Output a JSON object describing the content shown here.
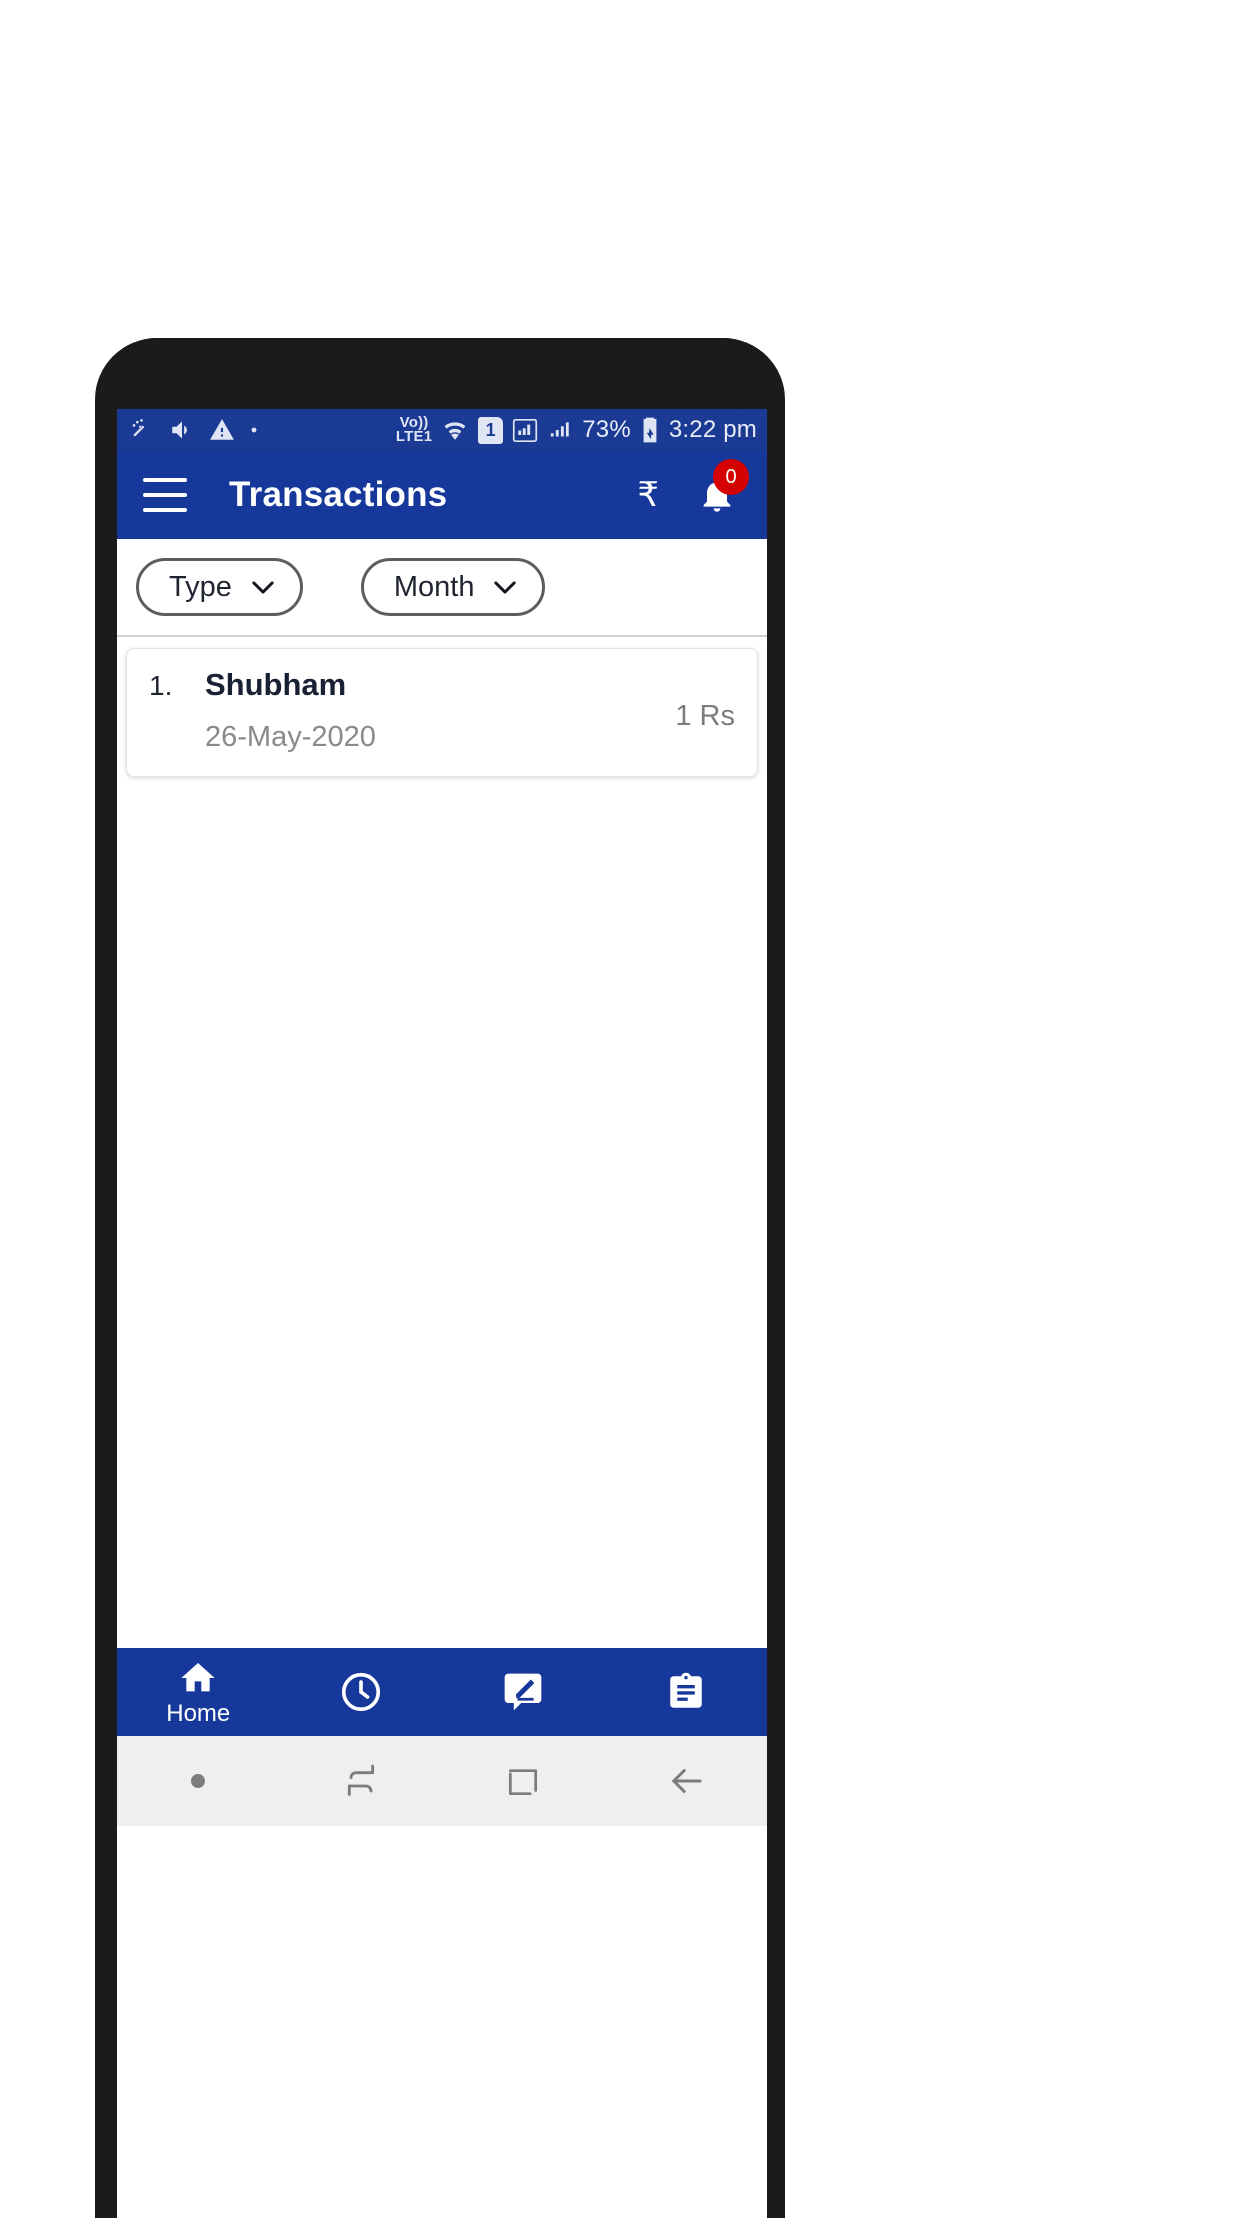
{
  "status_bar": {
    "left_icons": [
      "magic-wand-icon",
      "volume-icon",
      "warning-icon",
      "dot-icon"
    ],
    "network_label": "Vo)) LTE1",
    "network_line1": "Vo))",
    "network_line2": "LTE1",
    "right_icons": [
      "wifi-icon",
      "sim1-icon",
      "signal-icon",
      "signal2-icon"
    ],
    "sim_label": "1",
    "battery_percent": "73%",
    "battery_icon": "battery-charging-icon",
    "time": "3:22 pm"
  },
  "app_bar": {
    "menu_icon": "hamburger-menu-icon",
    "title": "Transactions",
    "currency_icon": "rupee-icon",
    "currency_glyph": "₹",
    "notification_icon": "bell-icon",
    "notification_count": "0",
    "bg_color": "#17389b",
    "badge_color": "#d50000"
  },
  "filters": [
    {
      "label": "Type",
      "icon": "chevron-down-icon"
    },
    {
      "label": "Month",
      "icon": "chevron-down-icon"
    }
  ],
  "transactions": [
    {
      "index": "1.",
      "name": "Shubham",
      "date": "26-May-2020",
      "amount": "1 Rs"
    }
  ],
  "bottom_nav": [
    {
      "icon": "home-icon",
      "label": "Home"
    },
    {
      "icon": "history-clock-icon",
      "label": ""
    },
    {
      "icon": "feedback-message-icon",
      "label": ""
    },
    {
      "icon": "clipboard-icon",
      "label": ""
    }
  ],
  "system_nav": [
    {
      "icon": "dot-icon"
    },
    {
      "icon": "switch-apps-icon"
    },
    {
      "icon": "recents-square-icon"
    },
    {
      "icon": "back-arrow-icon"
    }
  ]
}
